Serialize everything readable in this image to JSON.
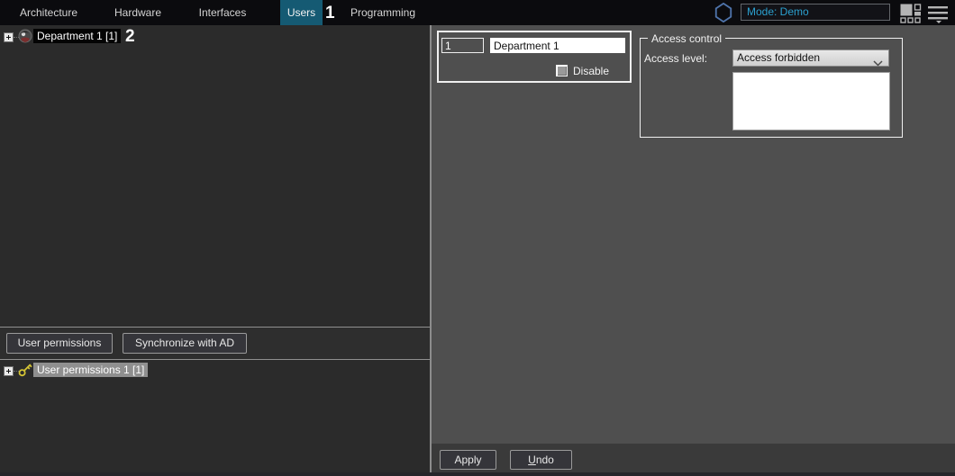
{
  "tabs": [
    {
      "label": "Architecture"
    },
    {
      "label": "Hardware"
    },
    {
      "label": "Interfaces"
    },
    {
      "label": "Users"
    },
    {
      "label": "Programming"
    }
  ],
  "topbar": {
    "mode_value": "Mode: Demo"
  },
  "callouts": {
    "step1": "1",
    "step2": "2"
  },
  "departments_tree": {
    "selected_item": "Department 1 [1]"
  },
  "permissions_tree": {
    "selected_item": "User permissions 1 [1]"
  },
  "actions": {
    "user_permissions": "User permissions",
    "synchronize_ad": "Synchronize with AD",
    "apply": "Apply",
    "undo_u": "U",
    "undo_rest": "ndo"
  },
  "department_form": {
    "id_value": "1",
    "name_value": "Department 1",
    "disable_label": "Disable"
  },
  "access_control": {
    "group_title": "Access control",
    "level_label": "Access level:",
    "level_value": "Access forbidden"
  },
  "colors": {
    "selected_tab": "#155a73",
    "mode_text": "#2ba0cf",
    "key_icon": "#d4c435",
    "active_selection": "#040404",
    "inactive_selection": "#8f8f8f",
    "panel_right": "#4f4f4f",
    "panel_left": "#2b2b2b"
  }
}
